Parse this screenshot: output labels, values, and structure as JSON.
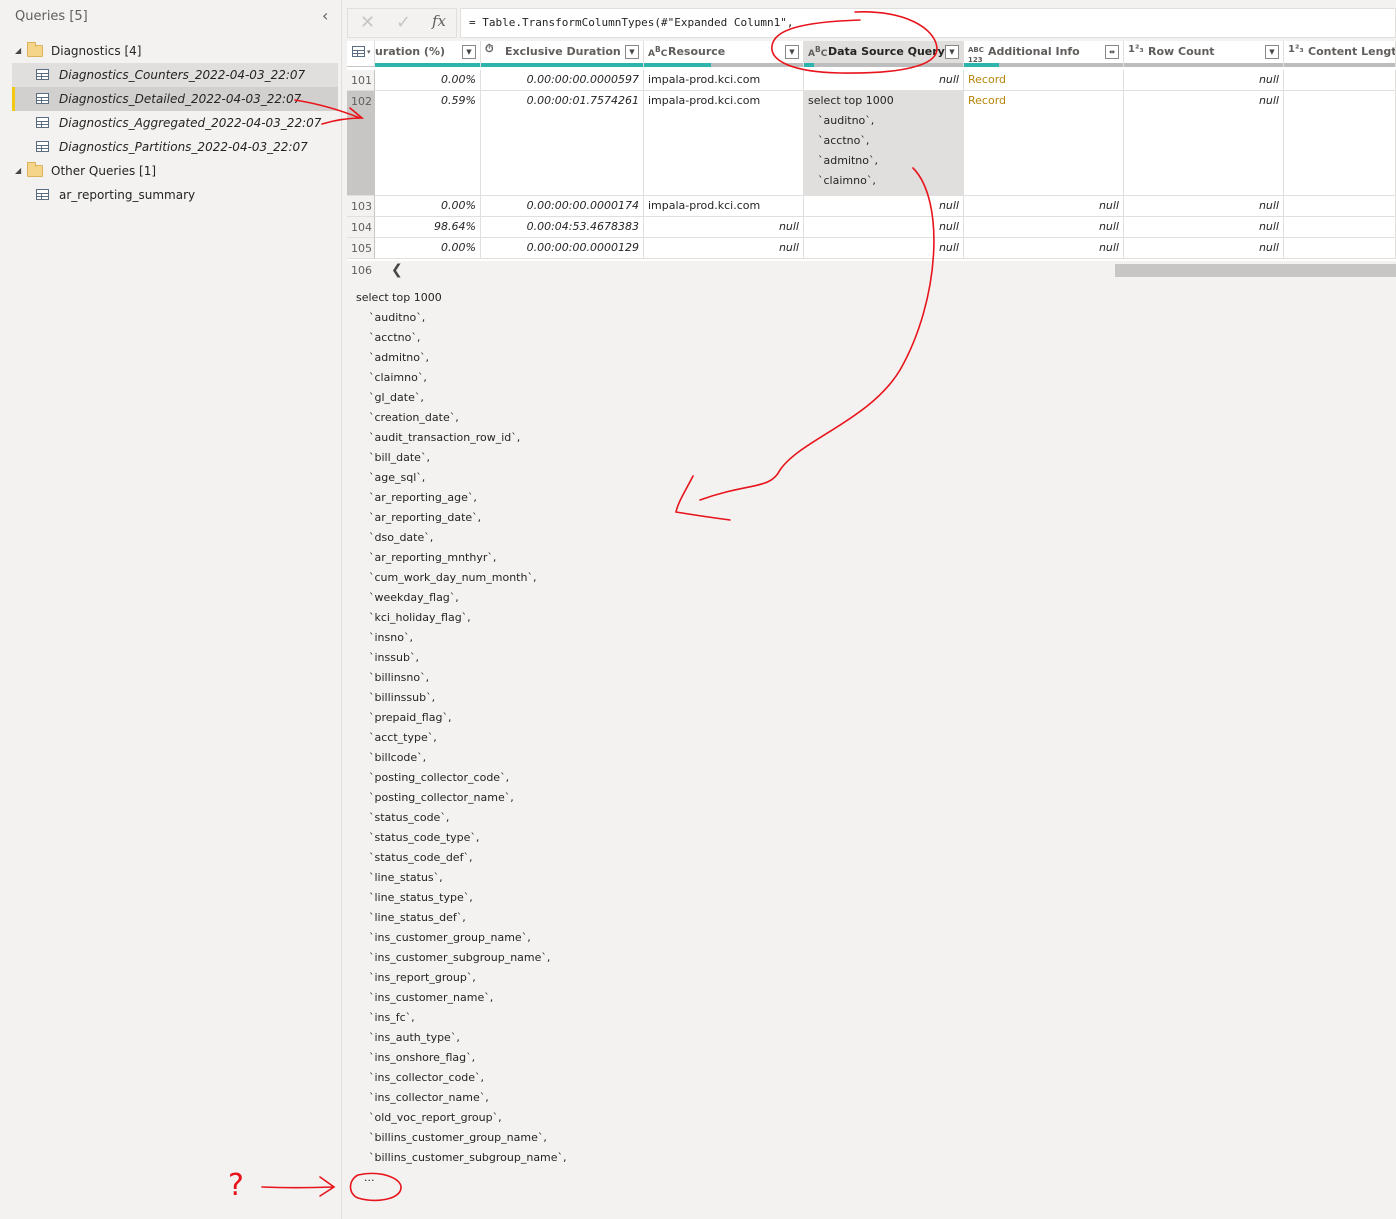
{
  "queries_pane": {
    "header": "Queries [5]",
    "collapse_icon": "chevron-left-icon",
    "groups": [
      {
        "label": "Diagnostics [4]",
        "items": [
          "Diagnostics_Counters_2022-04-03_22:07",
          "Diagnostics_Detailed_2022-04-03_22:07",
          "Diagnostics_Aggregated_2022-04-03_22:07",
          "Diagnostics_Partitions_2022-04-03_22:07"
        ]
      },
      {
        "label": "Other Queries [1]",
        "items": [
          "ar_reporting_summary"
        ]
      }
    ],
    "selected_item": "Diagnostics_Detailed_2022-04-03_22:07"
  },
  "formula_bar": {
    "cancel": "✕",
    "commit": "✓",
    "fx": "fx",
    "formula": "= Table.TransformColumnTypes(#\"Expanded Column1\","
  },
  "grid": {
    "columns": [
      {
        "label": "uration (%)",
        "type": ""
      },
      {
        "label": "Exclusive Duration",
        "type": "⏱"
      },
      {
        "label": "Resource",
        "type": "ABC"
      },
      {
        "label": "Data Source Query",
        "type": "ABC"
      },
      {
        "label": "Additional Info",
        "type": "ABC123"
      },
      {
        "label": "Row Count",
        "type": "123"
      },
      {
        "label": "Content Length",
        "type": "123"
      }
    ],
    "rows": [
      {
        "num": "101",
        "pct": "0.00%",
        "dur": "0.00:00:00.0000597",
        "res": "impala-prod.kci.com",
        "query": [
          "null"
        ],
        "info": "Record",
        "count": "null"
      },
      {
        "num": "102",
        "pct": "0.59%",
        "dur": "0.00:00:01.7574261",
        "res": "impala-prod.kci.com",
        "query": [
          "select top 1000",
          "  `auditno`,",
          "  `acctno`,",
          "  `admitno`,",
          "  `claimno`,"
        ],
        "info": "Record",
        "count": "null"
      },
      {
        "num": "103",
        "pct": "0.00%",
        "dur": "0.00:00:00.0000174",
        "res": "impala-prod.kci.com",
        "query": [
          "null"
        ],
        "info": "null",
        "count": "null"
      },
      {
        "num": "104",
        "pct": "98.64%",
        "dur": "0.00:04:53.4678383",
        "res": "null",
        "query": [
          "null"
        ],
        "info": "null",
        "count": "null"
      },
      {
        "num": "105",
        "pct": "0.00%",
        "dur": "0.00:00:00.0000129",
        "res": "null",
        "query": [
          "null"
        ],
        "info": "null",
        "count": "null"
      }
    ],
    "last_row_num": "106",
    "scroll_left": "❮"
  },
  "details": {
    "lines": [
      "select top 1000",
      "`auditno`,",
      "`acctno`,",
      "`admitno`,",
      "`claimno`,",
      "`gl_date`,",
      "`creation_date`,",
      "`audit_transaction_row_id`,",
      "`bill_date`,",
      "`age_sql`,",
      "`ar_reporting_age`,",
      "`ar_reporting_date`,",
      "`dso_date`,",
      "`ar_reporting_mnthyr`,",
      "`cum_work_day_num_month`,",
      "`weekday_flag`,",
      "`kci_holiday_flag`,",
      "`insno`,",
      "`inssub`,",
      "`billinsno`,",
      "`billinssub`,",
      "`prepaid_flag`,",
      "`acct_type`,",
      "`billcode`,",
      "`posting_collector_code`,",
      "`posting_collector_name`,",
      "`status_code`,",
      "`status_code_type`,",
      "`status_code_def`,",
      "`line_status`,",
      "`line_status_type`,",
      "`line_status_def`,",
      "`ins_customer_group_name`,",
      "`ins_customer_subgroup_name`,",
      "`ins_report_group`,",
      "`ins_customer_name`,",
      "`ins_fc`,",
      "`ins_auth_type`,",
      "`ins_onshore_flag`,",
      "`ins_collector_code`,",
      "`ins_collector_name`,",
      "`old_voc_report_group`,",
      "`billins_customer_group_name`,",
      "`billins_customer_subgroup_name`,",
      "..."
    ]
  },
  "annotations": {
    "question": "?",
    "color": "#e8141b"
  }
}
